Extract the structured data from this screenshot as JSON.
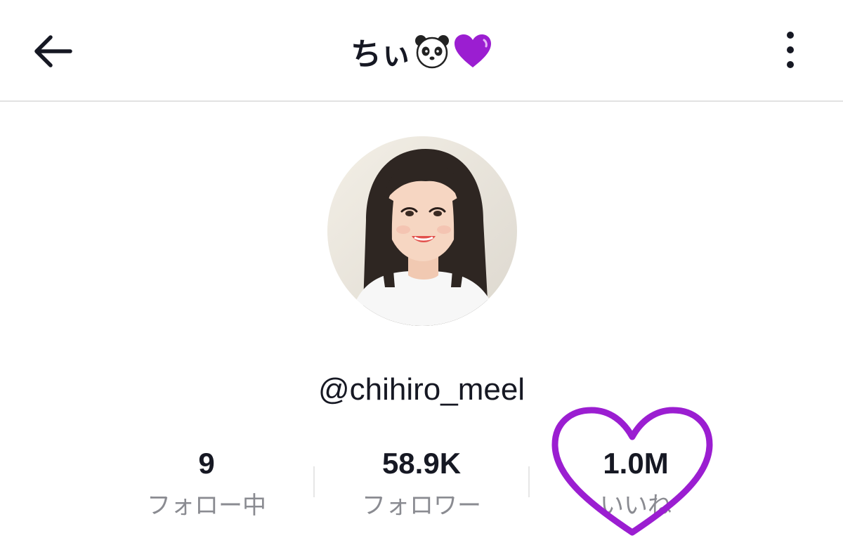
{
  "header": {
    "title_text": "ちぃ",
    "title_icons": [
      "panda-face-icon",
      "purple-heart-icon"
    ],
    "back_icon": "arrow-left-icon",
    "more_icon": "vertical-dots-icon"
  },
  "profile": {
    "username": "@chihiro_meel"
  },
  "stats": [
    {
      "value": "9",
      "label": "フォロー中"
    },
    {
      "value": "58.9K",
      "label": "フォロワー"
    },
    {
      "value": "1.0M",
      "label": "いいね"
    }
  ],
  "annotation": {
    "icon": "purple-heart-outline-icon"
  },
  "colors": {
    "text_primary": "#161823",
    "text_secondary": "#8a8b91",
    "divider": "#e2e2e2",
    "accent_purple": "#9b1ed1"
  }
}
